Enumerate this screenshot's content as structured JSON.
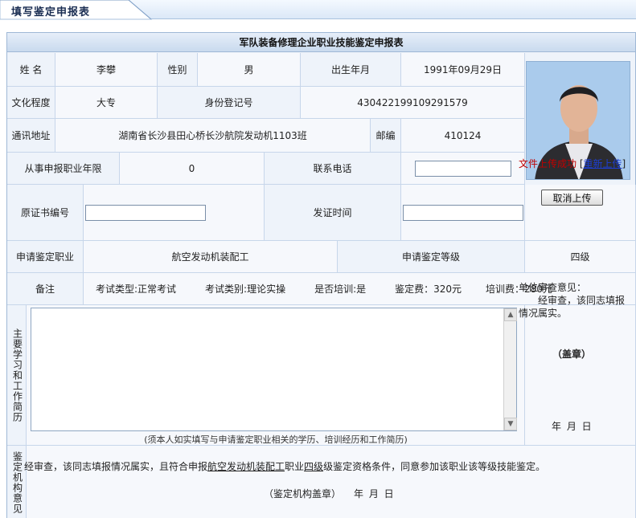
{
  "tab": {
    "title": "填写鉴定申报表"
  },
  "form": {
    "caption": "军队装备修理企业职业技能鉴定申报表",
    "name_label": "姓 名",
    "name_value": "李攀",
    "gender_label": "性别",
    "gender_value": "男",
    "birth_label": "出生年月",
    "birth_value": "1991年09月29日",
    "education_label": "文化程度",
    "education_value": "大专",
    "id_label": "身份登记号",
    "id_value": "430422199109291579",
    "address_label": "通讯地址",
    "address_value": "湖南省长沙县田心桥长沙航院发动机1103班",
    "zip_label": "邮编",
    "zip_value": "410124",
    "years_label": "从事申报职业年限",
    "years_value": "0",
    "phone_label": "联系电话",
    "phone_value": "",
    "cert_no_label": "原证书编号",
    "cert_no_value": "",
    "issue_time_label": "发证时间",
    "issue_time_value": "",
    "upload_status": "文件上传成功",
    "reupload_link": "重新上传",
    "cancel_upload": "取消上传",
    "occupation_label": "申请鉴定职业",
    "occupation_value": "航空发动机装配工",
    "level_label": "申请鉴定等级",
    "level_value": "四级",
    "remark_label": "备注",
    "remark_exam_type": "考试类型:正常考试",
    "remark_exam_category": "考试类别:理论实操",
    "remark_training": "是否培训:是",
    "remark_fee": "鉴定费：320元",
    "remark_training_fee": "培训费：280元",
    "study_label": "主要学习和工作简历",
    "study_value": "",
    "study_note": "(须本人如实填写与申请鉴定职业相关的学历、培训经历和工作简历)",
    "unit_opinion": "单位审查意见：",
    "unit_opinion_text": "经审查，该同志填报情况属实。",
    "stamp": "（盖章）",
    "ymd": "年 月 日",
    "agency_label": "鉴定机构意见",
    "agency_text_1": "经审查，该同志填报情况属实，且符合申报",
    "agency_occupation": "航空发动机装配工",
    "agency_text_2": "职业",
    "agency_level": "四级",
    "agency_text_3": "级鉴定资格条件，同意参加该职业该等级技能鉴定。",
    "agency_stamp": "（鉴定机构盖章）",
    "agency_ymd": "年 月 日"
  },
  "colors": {
    "accent": "#1a2d52",
    "border": "#9fb8d6",
    "success": "#c00000",
    "link": "#1d3fd6"
  }
}
